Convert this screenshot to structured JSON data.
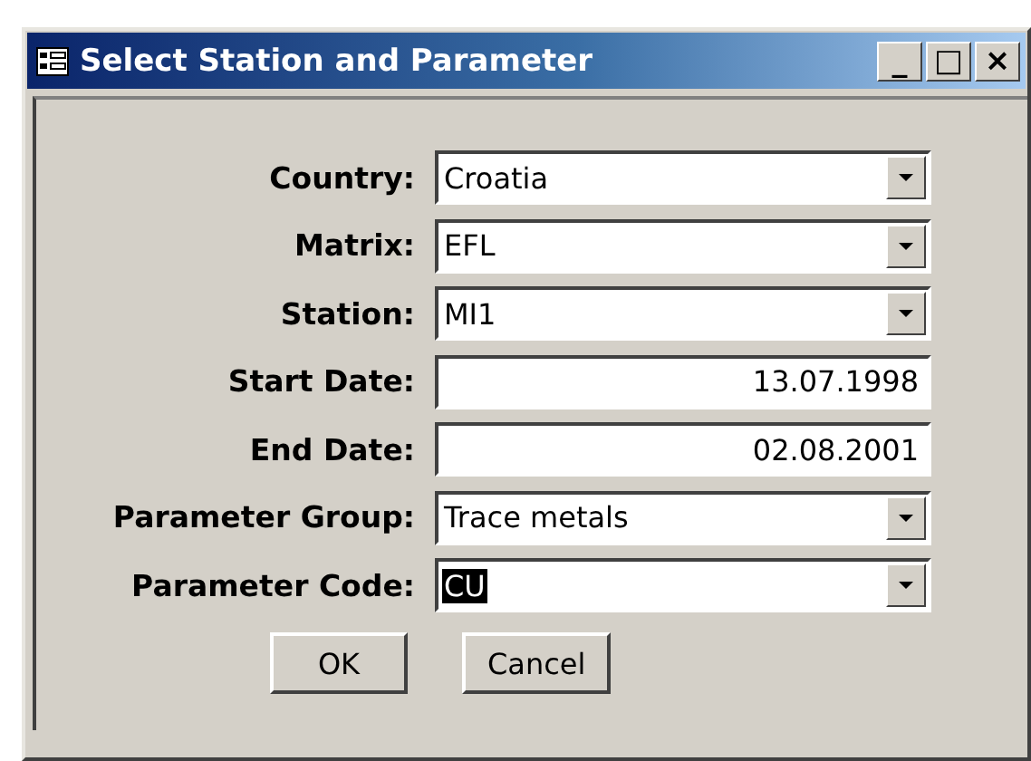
{
  "window": {
    "title": "Select Station and Parameter",
    "controls": [
      "_",
      "□",
      "×"
    ]
  },
  "fields": [
    {
      "label": "Country:",
      "kind": "combo",
      "value": "Croatia",
      "highlighted": false
    },
    {
      "label": "Matrix:",
      "kind": "combo",
      "value": "EFL",
      "highlighted": false
    },
    {
      "label": "Station:",
      "kind": "combo",
      "value": "MI1",
      "highlighted": false
    },
    {
      "label": "Start Date:",
      "kind": "text",
      "value": "13.07.1998",
      "highlighted": false
    },
    {
      "label": "End Date:",
      "kind": "text",
      "value": "02.08.2001",
      "highlighted": false
    },
    {
      "label": "Parameter Group:",
      "kind": "combo",
      "value": "Trace metals",
      "highlighted": false
    },
    {
      "label": "Parameter Code:",
      "kind": "combo",
      "value": "CU",
      "highlighted": true
    }
  ],
  "buttons": [
    "OK",
    "Cancel"
  ]
}
